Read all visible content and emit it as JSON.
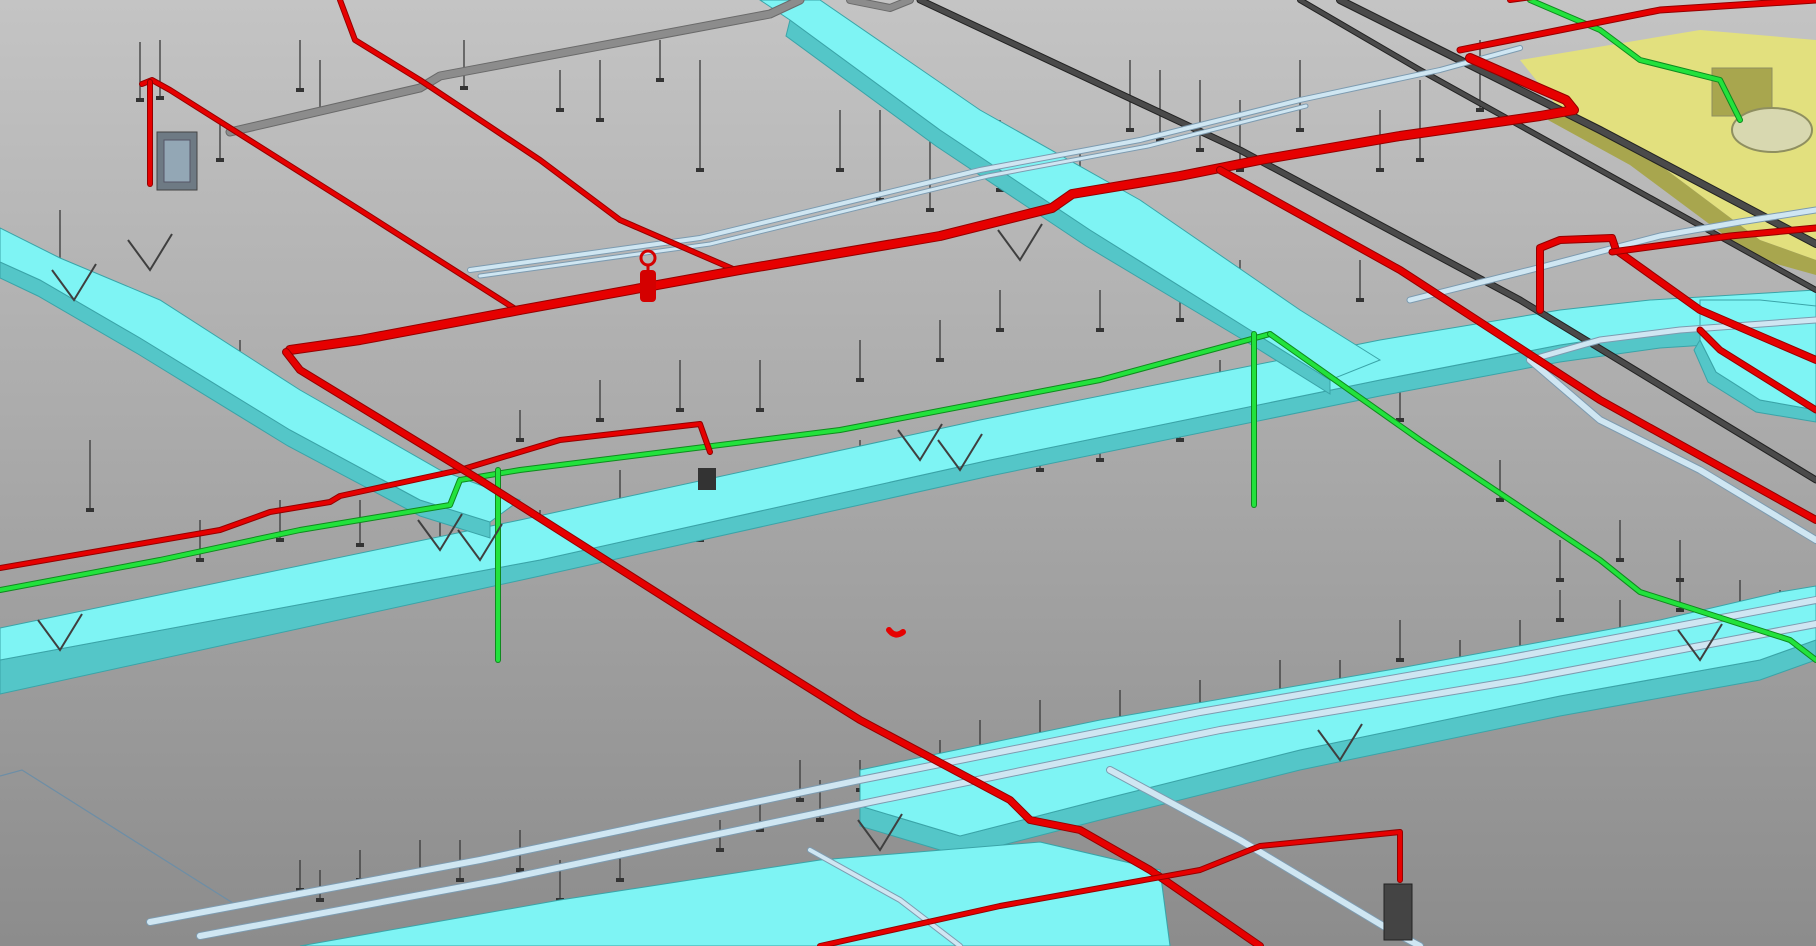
{
  "view": {
    "type": "3D MEP coordination model view (no visible text)",
    "background": {
      "top": "#c4c4c4",
      "bottom": "#8c8c8c"
    }
  },
  "systems": [
    {
      "id": "supply-air-duct",
      "color": "#7ef4f4",
      "shade": "#54c6c8",
      "edge": "#3aa4a8"
    },
    {
      "id": "fire-protection-pipe",
      "color": "#e60000",
      "dark": "#930000"
    },
    {
      "id": "condensate-drain-pipe",
      "color": "#22e23c",
      "dark": "#0f8a1e"
    },
    {
      "id": "chilled-water-pipe",
      "color": "#cfe6f2",
      "dark": "#7d9bb0"
    },
    {
      "id": "sanitary-pipe-dark",
      "color": "#4a4a4a",
      "dark": "#222222"
    },
    {
      "id": "gray-conduit",
      "color": "#8c8c8c",
      "dark": "#6a6a6a"
    },
    {
      "id": "equipment-yellow",
      "color": "#e2e07e",
      "dark": "#a8a64e"
    },
    {
      "id": "hanger-rod",
      "color": "#3a3a3a"
    }
  ]
}
